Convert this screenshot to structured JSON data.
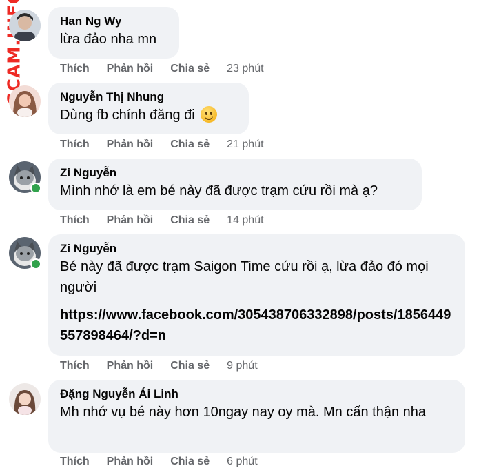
{
  "watermark": "SCAM.INFO",
  "action_labels": {
    "like": "Thích",
    "reply": "Phản hồi",
    "share": "Chia sẻ"
  },
  "comments": [
    {
      "author": "Han Ng Wy",
      "text": "lừa đảo nha mn",
      "time": "23 phút"
    },
    {
      "author": "Nguyễn Thị Nhung",
      "text": "Dùng fb chính đăng đi",
      "emoji": "smiling-face-icon",
      "time": "21 phút"
    },
    {
      "author": "Zi Nguyễn",
      "text": "Mình nhớ là em bé này đã được trạm cứu rồi mà ạ?",
      "time": "14 phút"
    },
    {
      "author": "Zi Nguyễn",
      "text": "Bé này đã được trạm Saigon Time cứu rồi ạ, lừa đảo đó mọi người",
      "link": "https://www.facebook.com/305438706332898/posts/1856449557898464/?d=n",
      "time": "9 phút"
    },
    {
      "author": "Đặng Nguyễn Ái Linh",
      "text": "Mh nhớ vụ bé này hơn 10ngay nay oy mà. Mn cẩn thận nha",
      "time": "6 phút"
    }
  ],
  "colors": {
    "bubble": "#f0f2f5",
    "meta": "#65676b",
    "online": "#31a24c",
    "watermark": "#ee2a24"
  }
}
